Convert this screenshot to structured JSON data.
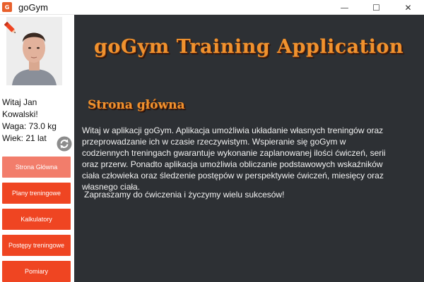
{
  "window": {
    "title": "goGym",
    "app_icon_text": "G",
    "controls": {
      "minimize": "—",
      "maximize": "☐",
      "close": "✕"
    }
  },
  "sidebar": {
    "user": {
      "greeting": "Witaj Jan Kowalski!",
      "weight": "Waga: 73.0 kg",
      "age": "Wiek: 21 lat"
    },
    "nav": [
      {
        "label": "Strona Główna",
        "active": true
      },
      {
        "label": "Plany treningowe",
        "active": false
      },
      {
        "label": "Kalkulatory",
        "active": false
      },
      {
        "label": "Postępy treningowe",
        "active": false
      },
      {
        "label": "Pomiary",
        "active": false
      }
    ]
  },
  "main": {
    "app_title": "goGym Training Application",
    "section_title": "Strona główna",
    "description": "Witaj w aplikacji goGym. Aplikacja umożliwia układanie własnych treningów oraz przeprowadzanie ich w czasie rzeczywistym. Wspieranie się goGym w codziennych treningach gwarantuje wykonanie zaplanowanej ilości ćwiczeń, serii oraz przerw. Ponadto aplikacja umożliwia obliczanie podstawowych wskaźników ciała człowieka oraz śledzenie postępów w perspektywie ćwiczeń, miesięcy oraz własnego ciała.",
    "closing": "Zapraszamy do ćwiczenia i życzymy wielu sukcesów!"
  },
  "colors": {
    "accent": "#ef4522",
    "accent_active": "#f27d6b",
    "title_orange": "#f0922e",
    "main_bg": "#2d3034"
  },
  "icons": [
    "pencil-edit-icon",
    "refresh-icon"
  ]
}
